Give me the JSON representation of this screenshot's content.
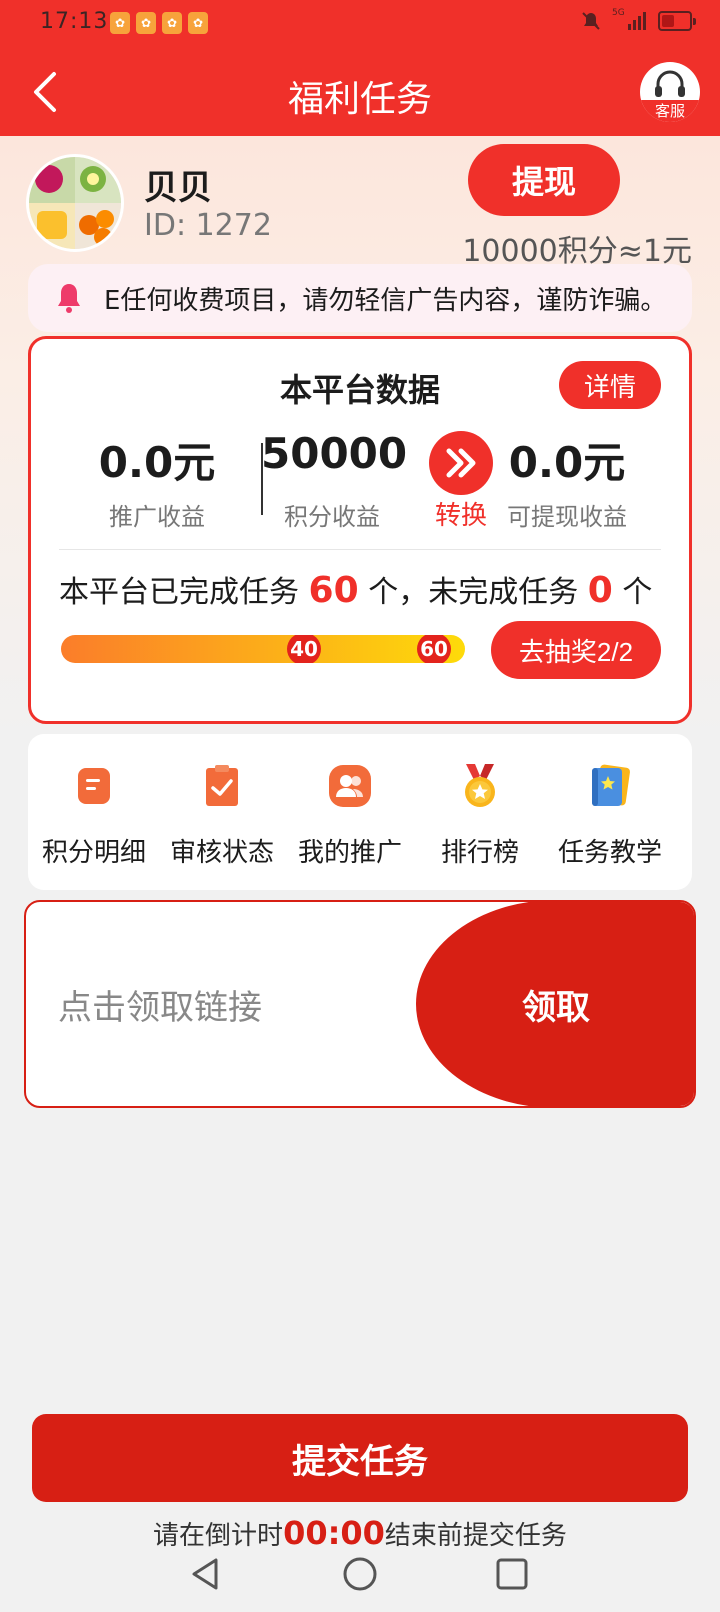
{
  "status": {
    "time": "17:13",
    "signal": "5G"
  },
  "header": {
    "title": "福利任务",
    "service_label": "客服"
  },
  "user": {
    "name": "贝贝",
    "id_text": "ID: 1272"
  },
  "withdraw": {
    "label": "提现",
    "rate_text": "10000积分≈1元"
  },
  "notice": {
    "text": "E任何收费项目，请勿轻信广告内容，谨防诈骗。"
  },
  "stats": {
    "title": "本平台数据",
    "detail_label": "详情",
    "promo_value": "0.0元",
    "promo_label": "推广收益",
    "points_value": "50000",
    "points_label": "积分收益",
    "convert_label": "转换",
    "cash_value": "0.0元",
    "cash_label": "可提现收益",
    "tasks_prefix": "本平台已完成任务",
    "completed": "60",
    "tasks_mid": "个，未完成任务",
    "uncompleted": "0",
    "tasks_suffix": "个",
    "milestone_1": "40",
    "milestone_2": "60",
    "progress_fraction": 1.0,
    "draw_label": "去抽奖2/2"
  },
  "menu": [
    {
      "label": "积分明细",
      "icon": "points-detail-icon"
    },
    {
      "label": "审核状态",
      "icon": "clipboard-check-icon"
    },
    {
      "label": "我的推广",
      "icon": "users-icon"
    },
    {
      "label": "排行榜",
      "icon": "medal-icon"
    },
    {
      "label": "任务教学",
      "icon": "book-icon"
    }
  ],
  "link": {
    "placeholder": "点击领取链接",
    "claim_label": "领取"
  },
  "submit": {
    "label": "提交任务"
  },
  "countdown": {
    "prefix": "请在倒计时",
    "time": "00:00",
    "suffix": "结束前提交任务"
  },
  "colors": {
    "primary": "#f0302a",
    "dark_red": "#d71f14"
  }
}
